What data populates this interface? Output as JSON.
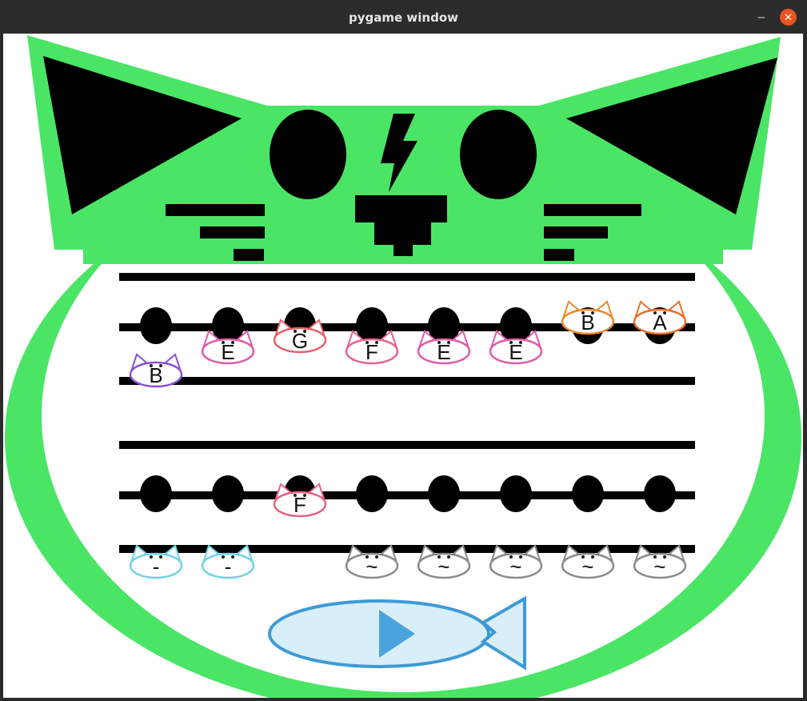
{
  "window": {
    "title": "pygame window",
    "minimize_glyph": "–",
    "close_glyph": "✕"
  },
  "colors": {
    "cat_green": "#4be566",
    "black": "#000000",
    "fish_fill": "#d8eef8",
    "fish_stroke": "#3d9ad6",
    "play_icon": "#4aa3dc"
  },
  "face": {
    "ears": "black-triangles",
    "eyes": "black-ovals",
    "nose_icon": "lightning-bolt-icon",
    "mouth": "black-stepped-nose",
    "whiskers": "three-bars-each-side"
  },
  "staves": [
    {
      "id": "top",
      "columns": [
        {
          "top_note": "",
          "bottom": {
            "label": "B",
            "color": "#8a52d8"
          }
        },
        {
          "top_note": "",
          "bottom": {
            "label": "E",
            "color": "#e05aa8"
          }
        },
        {
          "top_note": "G",
          "top_color": "#e8606a",
          "bottom": null
        },
        {
          "top_note": "",
          "bottom": {
            "label": "F",
            "color": "#e86090"
          }
        },
        {
          "top_note": "",
          "bottom": {
            "label": "E",
            "color": "#e05aa8"
          }
        },
        {
          "top_note": "",
          "bottom": {
            "label": "E",
            "color": "#e05aa8"
          }
        },
        {
          "top_note": "B",
          "top_color": "#ec8a2a",
          "bottom": null
        },
        {
          "top_note": "A",
          "top_color": "#e8702a",
          "bottom": null
        }
      ]
    },
    {
      "id": "bottom",
      "columns": [
        {
          "top_note": "",
          "bottom": {
            "label": "-",
            "color": "#6cd4e6"
          }
        },
        {
          "top_note": "",
          "bottom": {
            "label": "-",
            "color": "#6cd4e6"
          }
        },
        {
          "top_note": "F",
          "top_color": "#e86080",
          "bottom": null
        },
        {
          "top_note": "",
          "bottom": {
            "label": "~",
            "color": "#8a8a8a"
          }
        },
        {
          "top_note": "",
          "bottom": {
            "label": "~",
            "color": "#8a8a8a"
          }
        },
        {
          "top_note": "",
          "bottom": {
            "label": "~",
            "color": "#8a8a8a"
          }
        },
        {
          "top_note": "",
          "bottom": {
            "label": "~",
            "color": "#8a8a8a"
          }
        },
        {
          "top_note": "",
          "bottom": {
            "label": "~",
            "color": "#8a8a8a"
          }
        }
      ]
    }
  ],
  "play_button": {
    "icon": "play-icon",
    "shape": "fish"
  }
}
